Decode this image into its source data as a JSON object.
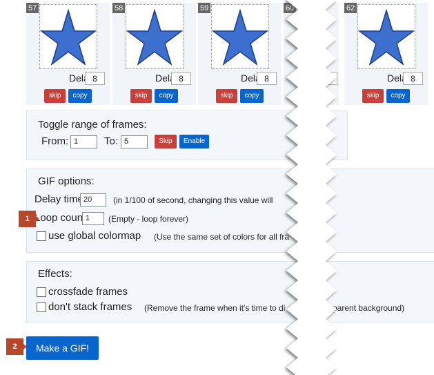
{
  "frames": [
    {
      "number": "57",
      "delay_label": "Delay:",
      "delay": "8",
      "skip": "skip",
      "copy": "copy"
    },
    {
      "number": "58",
      "delay_label": "Delay:",
      "delay": "8",
      "skip": "skip",
      "copy": "copy"
    },
    {
      "number": "59",
      "delay_label": "Delay:",
      "delay": "8",
      "skip": "skip",
      "copy": "copy"
    },
    {
      "number": "60"
    },
    {
      "number": "62",
      "delay_label": "Delay:",
      "delay": "8",
      "skip": "skip",
      "copy": "copy"
    }
  ],
  "toggle": {
    "title": "Toggle range of frames:",
    "from_label": "From:",
    "from": "1",
    "to_label": "To:",
    "to": "5",
    "skip": "Skip",
    "enable": "Enable"
  },
  "gif_options": {
    "title": "GIF options:",
    "delay_label": "Delay time:",
    "delay": "20",
    "delay_note": "(in 1/100 of second, changing this value will",
    "loop_label": "Loop count:",
    "loop": "1",
    "loop_note": "(Empty - loop forever)",
    "colormap_label": "use global colormap",
    "colormap_note": "(Use the same set of colors for all fra"
  },
  "effects": {
    "title": "Effects:",
    "crossfade_label": "crossfade frames",
    "nostack_label": "don't stack frames",
    "nostack_note_left": "(Remove the frame when it's time to di",
    "nostack_note_right": "sparent background)"
  },
  "make_gif": "Make a GIF!",
  "badges": [
    "1",
    "2"
  ],
  "colors": {
    "skip": "#c9403a",
    "blue": "#0865cc",
    "badge": "#b7472a",
    "star": "#3d6fcf"
  }
}
